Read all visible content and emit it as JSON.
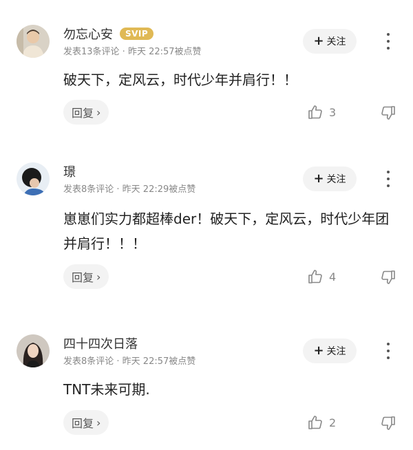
{
  "comments": [
    {
      "name": "勿忘心安",
      "badge": "SVIP",
      "meta": "发表13条评论 · 昨天 22:57被点赞",
      "follow_label": "关注",
      "content": "破天下，定风云，时代少年并肩行！！",
      "reply_label": "回复",
      "likes": "3",
      "avatar_icon": "user-photo-avatar"
    },
    {
      "name": "璟",
      "badge": "",
      "meta": "发表8条评论 · 昨天 22:29被点赞",
      "follow_label": "关注",
      "content": "崽崽们实力都超棒der！破天下，定风云，时代少年团并肩行！！！",
      "reply_label": "回复",
      "likes": "4",
      "avatar_icon": "user-photo-avatar"
    },
    {
      "name": "四十四次日落",
      "badge": "",
      "meta": "发表8条评论 · 昨天 22:57被点赞",
      "follow_label": "关注",
      "content": "TNT未来可期.",
      "reply_label": "回复",
      "likes": "2",
      "avatar_icon": "user-photo-avatar"
    }
  ],
  "colors": {
    "badge": "#e0b955",
    "pill_bg": "#f3f3f3",
    "meta_text": "#888888"
  }
}
